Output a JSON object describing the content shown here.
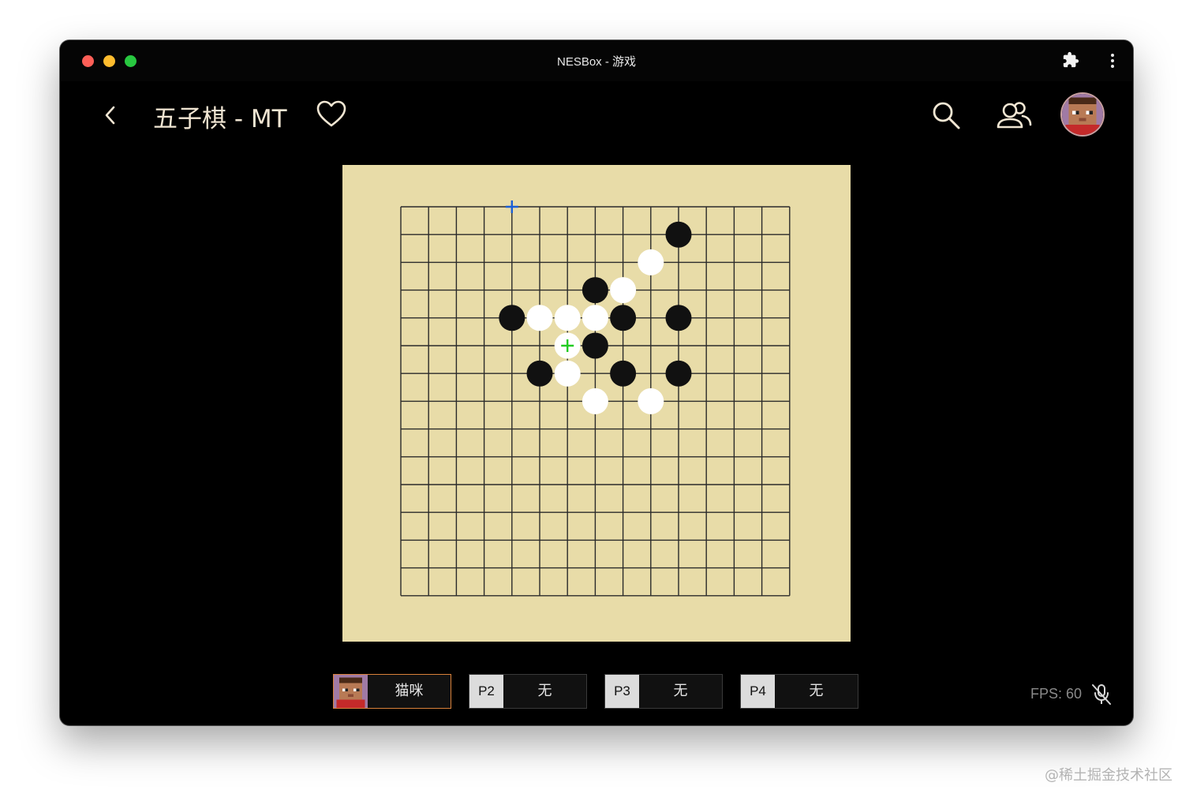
{
  "window": {
    "title": "NESBox - 游戏",
    "colors": {
      "close": "#fe5f57",
      "minimize": "#febc2e",
      "zoom": "#28c840"
    }
  },
  "appbar": {
    "game_title": "五子棋 - MT",
    "icons": [
      "back-icon",
      "heart-icon",
      "search-icon",
      "users-icon",
      "avatar"
    ]
  },
  "board": {
    "size": 15,
    "colors": {
      "board": "#e8dca8",
      "line": "#2a2a2a",
      "black": "#111111",
      "white": "#ffffff",
      "cursor_p1": "#1a5fd6",
      "cursor_p2": "#22cc22"
    },
    "black_stones": [
      [
        10,
        1
      ],
      [
        7,
        3
      ],
      [
        4,
        4
      ],
      [
        8,
        4
      ],
      [
        10,
        4
      ],
      [
        7,
        5
      ],
      [
        5,
        6
      ],
      [
        8,
        6
      ],
      [
        10,
        6
      ]
    ],
    "white_stones": [
      [
        9,
        2
      ],
      [
        8,
        3
      ],
      [
        5,
        4
      ],
      [
        6,
        4
      ],
      [
        7,
        4
      ],
      [
        6,
        5
      ],
      [
        6,
        6
      ],
      [
        7,
        7
      ],
      [
        9,
        7
      ]
    ],
    "cursors": [
      {
        "player": "P1",
        "col": 4,
        "row": 0,
        "color": "#1a5fd6"
      },
      {
        "player": "P2",
        "col": 6,
        "row": 5,
        "color": "#22cc22"
      }
    ]
  },
  "players": [
    {
      "slot": "P1",
      "name": "猫咪",
      "active": true,
      "has_avatar": true
    },
    {
      "slot": "P2",
      "name": "无",
      "active": false
    },
    {
      "slot": "P3",
      "name": "无",
      "active": false
    },
    {
      "slot": "P4",
      "name": "无",
      "active": false
    }
  ],
  "status": {
    "fps": "FPS: 60"
  },
  "watermark": "@稀土掘金技术社区"
}
